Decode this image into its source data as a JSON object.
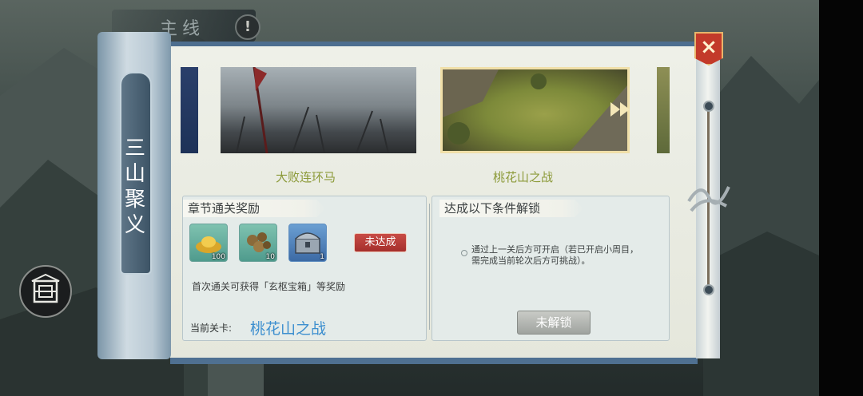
{
  "top_tab": {
    "label": "主线",
    "warn_icon": "!"
  },
  "chapter": {
    "title": "三山聚义"
  },
  "close": {
    "icon": "×"
  },
  "stages": [
    {
      "label": "大败连环马"
    },
    {
      "label": "桃花山之战"
    }
  ],
  "rewards": {
    "heading": "章节通关奖励",
    "items": [
      {
        "icon": "gold-ingot-icon",
        "count": "100"
      },
      {
        "icon": "coins-icon",
        "count": "10"
      },
      {
        "icon": "treasure-chest-icon",
        "count": "1"
      }
    ],
    "status": "未达成",
    "description": "首次通关可获得「玄枢宝箱」等奖励",
    "current_label": "当前关卡:",
    "current_value": "桃花山之战"
  },
  "unlock": {
    "heading": "达成以下条件解锁",
    "condition": "通过上一关后方可开启（若已开启小周目，需完成当前轮次后方可挑战）。",
    "button": "未解锁"
  }
}
